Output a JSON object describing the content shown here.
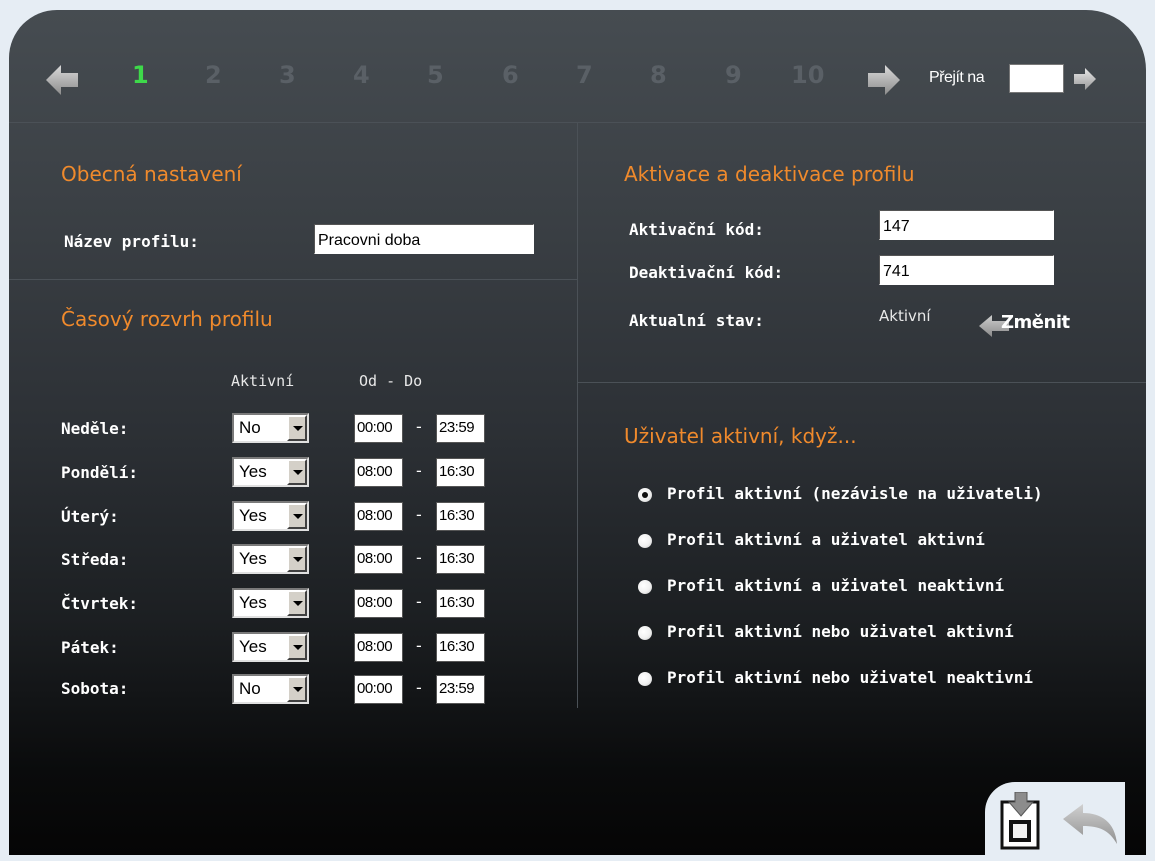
{
  "pager": {
    "pages": [
      "1",
      "2",
      "3",
      "4",
      "5",
      "6",
      "7",
      "8",
      "9",
      "10"
    ],
    "active_page": "1",
    "goto_label": "Přejít na",
    "goto_value": ""
  },
  "general": {
    "title": "Obecná nastavení",
    "profile_name_label": "Název profilu:",
    "profile_name_value": "Pracovni doba"
  },
  "schedule": {
    "title": "Časový rozvrh profilu",
    "col_active": "Aktivní",
    "col_from_to": "Od - Do",
    "days": [
      {
        "day": "Neděle:",
        "active": "No",
        "from": "00:00",
        "to": "23:59"
      },
      {
        "day": "Pondělí:",
        "active": "Yes",
        "from": "08:00",
        "to": "16:30"
      },
      {
        "day": "Úterý:",
        "active": "Yes",
        "from": "08:00",
        "to": "16:30"
      },
      {
        "day": "Středa:",
        "active": "Yes",
        "from": "08:00",
        "to": "16:30"
      },
      {
        "day": "Čtvrtek:",
        "active": "Yes",
        "from": "08:00",
        "to": "16:30"
      },
      {
        "day": "Pátek:",
        "active": "Yes",
        "from": "08:00",
        "to": "16:30"
      },
      {
        "day": "Sobota:",
        "active": "No",
        "from": "00:00",
        "to": "23:59"
      }
    ],
    "dash": "-"
  },
  "activation": {
    "title": "Aktivace a deaktivace profilu",
    "activation_code_label": "Aktivační kód:",
    "activation_code_value": "147",
    "deactivation_code_label": "Deaktivační kód:",
    "deactivation_code_value": "741",
    "state_label": "Aktualní stav:",
    "state_value": "Aktivní",
    "change_label": "Změnit"
  },
  "user_active": {
    "title": "Uživatel aktivní, když...",
    "options": [
      {
        "label": "Profil aktivní (nezávisle na uživateli)",
        "checked": true
      },
      {
        "label": "Profil aktivní a uživatel aktivní",
        "checked": false
      },
      {
        "label": "Profil aktivní a uživatel neaktivní",
        "checked": false
      },
      {
        "label": "Profil aktivní nebo uživatel aktivní",
        "checked": false
      },
      {
        "label": "Profil aktivní nebo uživatel neaktivní",
        "checked": false
      }
    ]
  },
  "colors": {
    "accent_orange": "#f08a2c",
    "active_page_green": "#3ed94a",
    "inactive_page_gray": "#5a6066",
    "page_background": "#e6edf4"
  },
  "icons": {
    "prev": "left-arrow-icon",
    "next": "right-arrow-icon",
    "go": "go-arrow-icon",
    "change": "back-arrow-icon",
    "save": "save-document-icon",
    "back": "undo-arrow-icon"
  }
}
